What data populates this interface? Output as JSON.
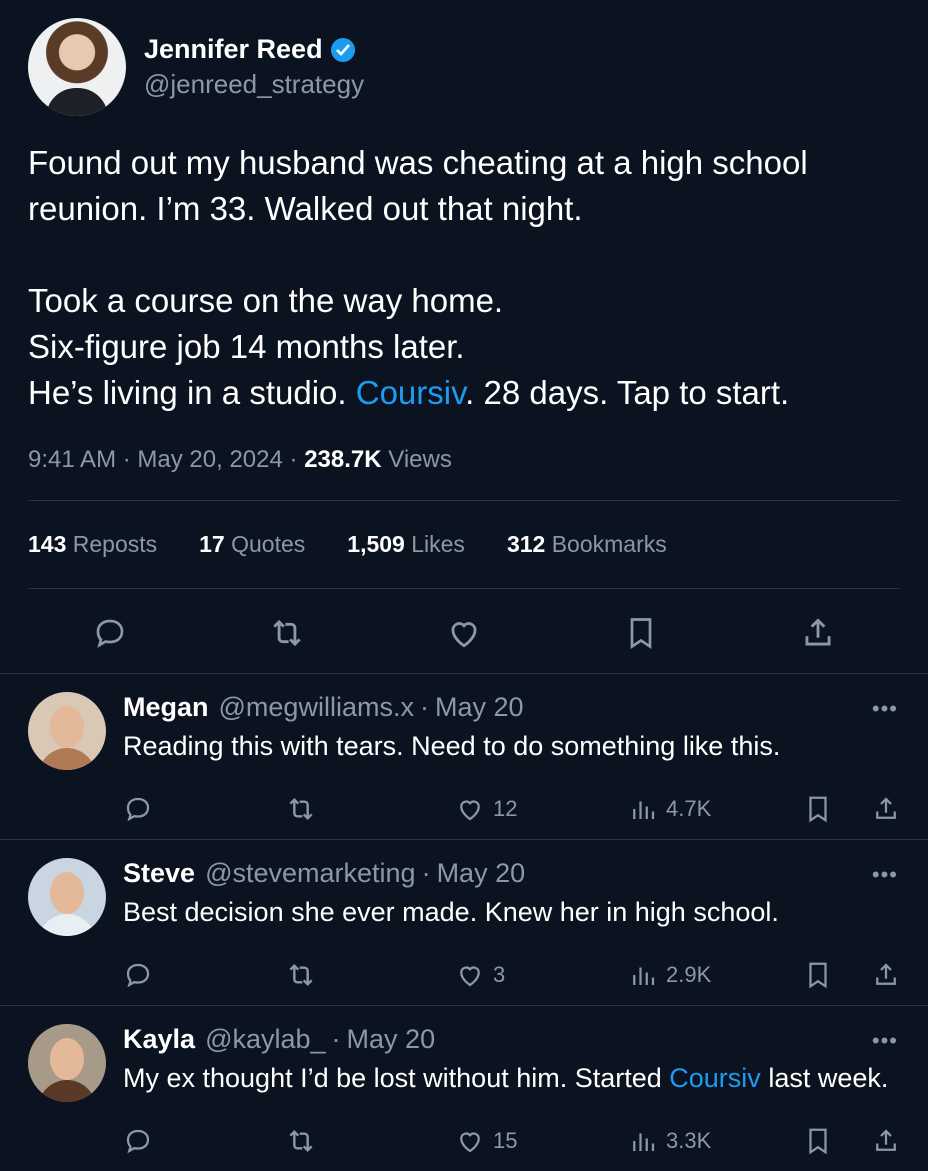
{
  "post": {
    "author_name": "Jennifer Reed",
    "author_handle": "@jenreed_strategy",
    "body_line1": "Found out my husband was cheating at a high school",
    "body_line2": "reunion. I’m 33. Walked out that night.",
    "body_line3": "Took a course on the way home.",
    "body_line4": "Six-figure job 14 months later.",
    "body_line5_pre": "He’s living in a studio. ",
    "body_line5_link": "Coursiv",
    "body_line5_post": ". 28 days. Tap to start.",
    "time": "9:41 AM",
    "date": "May 20, 2024",
    "views_count": "238.7K",
    "views_label": "Views",
    "reposts_count": "143",
    "reposts_label": "Reposts",
    "quotes_count": "17",
    "quotes_label": "Quotes",
    "likes_count": "1,509",
    "likes_label": "Likes",
    "bookmarks_count": "312",
    "bookmarks_label": "Bookmarks"
  },
  "replies": [
    {
      "name": "Megan",
      "handle": "@megwilliams.x",
      "date": "May 20",
      "text_pre": "Reading this with tears. Need to do something like this.",
      "text_link": "",
      "text_post": "",
      "likes": "12",
      "views": "4.7K",
      "avatar_color": "#b07a55"
    },
    {
      "name": "Steve",
      "handle": "@stevemarketing",
      "date": "May 20",
      "text_pre": "Best decision she ever made. Knew her in high school.",
      "text_link": "",
      "text_post": "",
      "likes": "3",
      "views": "2.9K",
      "avatar_color": "#6d4a33"
    },
    {
      "name": "Kayla",
      "handle": "@kaylab_",
      "date": "May 20",
      "text_pre": "My ex thought I’d be lost without him. Started ",
      "text_link": "Coursiv",
      "text_post": " last week.",
      "likes": "15",
      "views": "3.3K",
      "avatar_color": "#5a3a26"
    }
  ],
  "more_glyph": "•••",
  "colors": {
    "background": "#0b1320",
    "link": "#1d9bf0",
    "muted": "#8b98a5",
    "divider": "#2a3441"
  },
  "icons": [
    "verified-badge-icon",
    "reply-icon",
    "repost-icon",
    "like-icon",
    "bookmark-icon",
    "share-icon",
    "views-icon",
    "more-icon"
  ]
}
